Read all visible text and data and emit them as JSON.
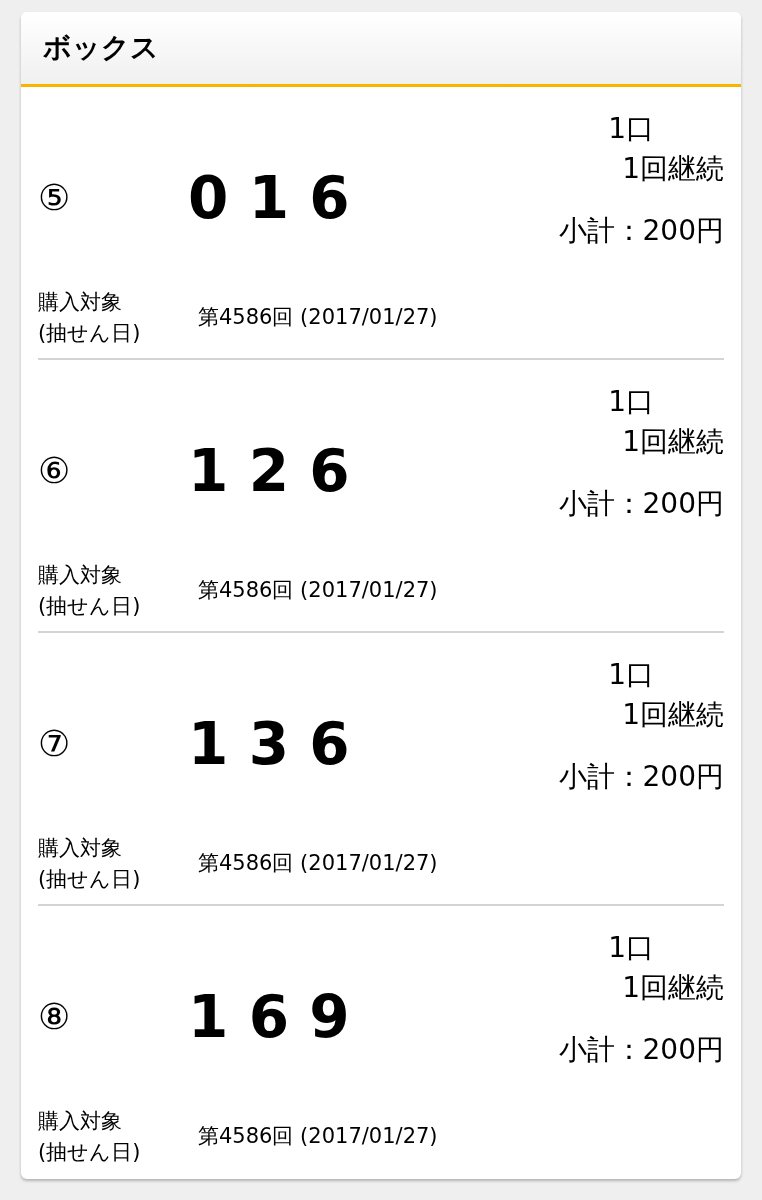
{
  "panel": {
    "title": "ボックス"
  },
  "entries": [
    {
      "index": "⑤",
      "number": "016",
      "units": "1口",
      "continuation": "1回継続",
      "subtotal": "小計：200円",
      "target_label": [
        "購入対象",
        "(抽せん日)"
      ],
      "target_value": "第4586回 (2017/01/27)"
    },
    {
      "index": "⑥",
      "number": "126",
      "units": "1口",
      "continuation": "1回継続",
      "subtotal": "小計：200円",
      "target_label": [
        "購入対象",
        "(抽せん日)"
      ],
      "target_value": "第4586回 (2017/01/27)"
    },
    {
      "index": "⑦",
      "number": "136",
      "units": "1口",
      "continuation": "1回継続",
      "subtotal": "小計：200円",
      "target_label": [
        "購入対象",
        "(抽せん日)"
      ],
      "target_value": "第4586回 (2017/01/27)"
    },
    {
      "index": "⑧",
      "number": "169",
      "units": "1口",
      "continuation": "1回継続",
      "subtotal": "小計：200円",
      "target_label": [
        "購入対象",
        "(抽せん日)"
      ],
      "target_value": "第4586回 (2017/01/27)"
    }
  ]
}
